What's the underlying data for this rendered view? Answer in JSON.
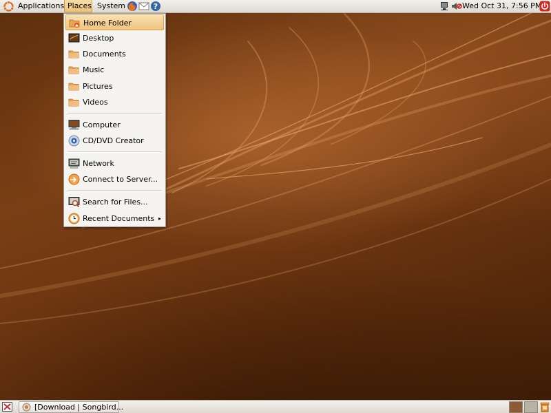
{
  "top_panel": {
    "menus": {
      "applications": "Applications",
      "places": "Places",
      "system": "System"
    },
    "clock": "Wed Oct 31,  7:56 PM"
  },
  "places_menu": {
    "items": [
      {
        "label": "Home Folder",
        "icon": "home-folder-icon"
      },
      {
        "label": "Desktop",
        "icon": "desktop-icon"
      },
      {
        "label": "Documents",
        "icon": "folder-icon"
      },
      {
        "label": "Music",
        "icon": "folder-icon"
      },
      {
        "label": "Pictures",
        "icon": "folder-icon"
      },
      {
        "label": "Videos",
        "icon": "folder-icon"
      },
      {
        "label": "Computer",
        "icon": "computer-icon"
      },
      {
        "label": "CD/DVD Creator",
        "icon": "cd-icon"
      },
      {
        "label": "Network",
        "icon": "network-icon"
      },
      {
        "label": "Connect to Server...",
        "icon": "connect-server-icon"
      },
      {
        "label": "Search for Files...",
        "icon": "search-icon"
      },
      {
        "label": "Recent Documents",
        "icon": "recent-documents-icon"
      }
    ],
    "submenu_arrow": "▸"
  },
  "taskbar": {
    "window_button": "[Download | Songbird..."
  },
  "colors": {
    "panel": "#e8e5df",
    "highlight": "#efc27a",
    "folder": "#e7a55a",
    "workspace_active": "#8c5a35",
    "workspace_inactive": "#b8b1a4"
  }
}
